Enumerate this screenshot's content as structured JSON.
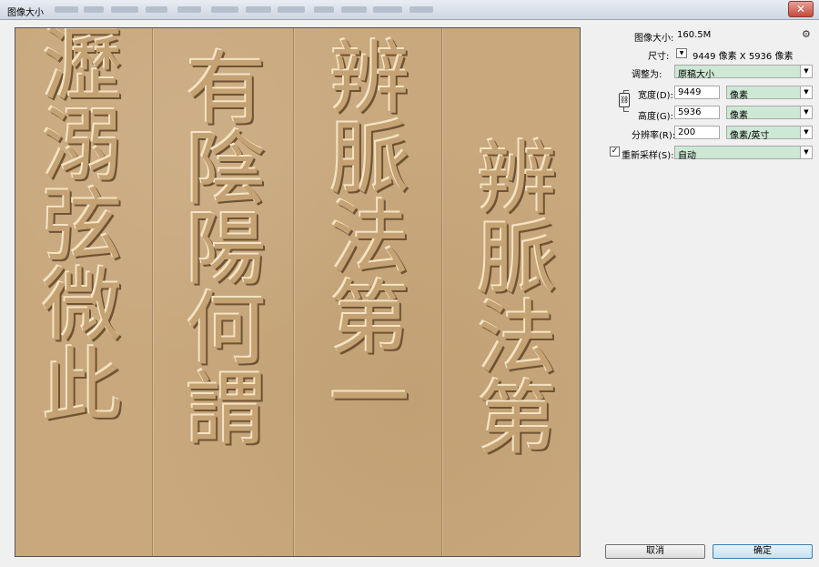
{
  "window": {
    "title": "图像大小",
    "close_glyph": "✕"
  },
  "preview": {
    "columns": [
      "瀝溺弦微此",
      "有陰陽何謂",
      "辨脈法第一",
      "辨脈法第"
    ]
  },
  "info": {
    "image_size_label": "图像大小:",
    "image_size_value": "160.5M",
    "dimensions_label": "尺寸:",
    "dimensions_value": "9449 像素  X  5936 像素"
  },
  "fit_to": {
    "label": "调整为:",
    "value": "原稿大小"
  },
  "width": {
    "label": "宽度(D):",
    "value": "9449",
    "unit": "像素"
  },
  "height": {
    "label": "高度(G):",
    "value": "5936",
    "unit": "像素"
  },
  "resolution": {
    "label": "分辨率(R):",
    "value": "200",
    "unit": "像素/英寸"
  },
  "resample": {
    "label": "重新采样(S):",
    "checked": true,
    "value": "自动"
  },
  "buttons": {
    "cancel": "取消",
    "ok": "确定"
  },
  "icons": {
    "gear": "gear-icon",
    "link": "link-icon",
    "dropdown": "chevron-down-icon"
  },
  "colors": {
    "dropdown_bg": "#cde8d4",
    "paper": "#c9a87d",
    "primary_btn": "#c4e2f4"
  }
}
